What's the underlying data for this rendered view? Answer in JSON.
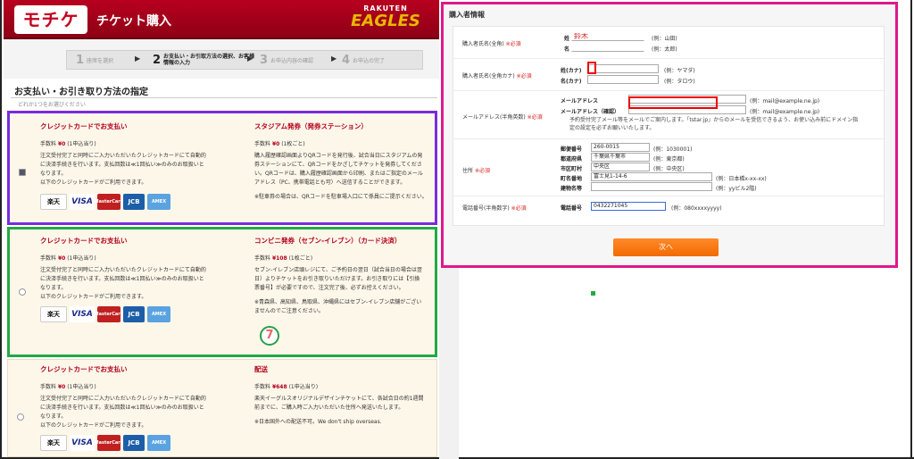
{
  "header": {
    "logo": "モチケ",
    "title": "チケット購入",
    "team_top": "RAKUTEN",
    "team_name": "EAGLES"
  },
  "steps": [
    {
      "num": "1",
      "label": "座席を選択"
    },
    {
      "num": "2",
      "label": "お支払い・お引取方法の選択、お客様情報の入力"
    },
    {
      "num": "3",
      "label": "お申込内容の確認"
    },
    {
      "num": "4",
      "label": "お申込の完了"
    }
  ],
  "section": {
    "title": "お支払い・お引き取り方法の指定",
    "subtitle": "どれか1つをお選びください"
  },
  "payment_cards": [
    {
      "left": {
        "title": "クレジットカードでお支払い",
        "fee_label": "手数料",
        "fee": "¥0",
        "fee_unit": "(1申込当り)",
        "lines": [
          "注文受付完了と同時にご入力いただいたクレジットカードにて自動的",
          "に決済手続きを行います。支払回数は≪1回払い≫のみのお取扱いと",
          "なります。",
          "以下のクレジットカードがご利用できます。"
        ]
      },
      "right": {
        "title": "スタジアム発券（発券ステーション）",
        "fee_label": "手数料",
        "fee": "¥0",
        "fee_unit": "(1枚ごと)",
        "lines": [
          "購入履歴確認画面よりQRコードを発行後、試合当日にスタジアムの発",
          "券ステーションにて、QRコードをかざしてチケットを発券してくださ",
          "い。QRコードは、購入履歴確認画面から印刷、またはご指定のメール",
          "アドレス（PC、携帯電話とも可）へ送信することができます。",
          "",
          "※駐車券の場合は、QRコードを駐車場入口にて係員にご提示ください。"
        ]
      }
    },
    {
      "left": {
        "title": "クレジットカードでお支払い",
        "fee_label": "手数料",
        "fee": "¥0",
        "fee_unit": "(1申込当り)",
        "lines": [
          "注文受付完了と同時にご入力いただいたクレジットカードにて自動的",
          "に決済手続きを行います。支払回数は≪1回払い≫のみのお取扱いと",
          "なります。",
          "以下のクレジットカードがご利用できます。"
        ]
      },
      "right": {
        "title": "コンビニ発券（セブン-イレブン）（カード決済）",
        "fee_label": "手数料",
        "fee": "¥108",
        "fee_unit": "(1枚ごと)",
        "lines": [
          "セブン-イレブン店頭レジにて、ご予約日の翌日（試合当日の場合は翌",
          "日）よりチケットをお引き取りいただけます。お引き取りには【引換",
          "票番号】が必要ですので、注文完了後、必ずお控えください。",
          "",
          "※青森県、高知県、鳥取県、沖縄県にはセブン-イレブン店舗がござい",
          "ませんのでご注意ください。"
        ]
      }
    },
    {
      "left": {
        "title": "クレジットカードでお支払い",
        "fee_label": "手数料",
        "fee": "¥0",
        "fee_unit": "(1申込当り)",
        "lines": [
          "注文受付完了と同時にご入力いただいたクレジットカードにて自動的",
          "に決済手続きを行います。支払回数は≪1回払い≫のみのお取扱いと",
          "なります。",
          "以下のクレジットカードがご利用できます。"
        ]
      },
      "right": {
        "title": "配送",
        "fee_label": "手数料",
        "fee": "¥648",
        "fee_unit": "(1申込当り)",
        "lines": [
          "楽天イーグルスオリジナルデザインチケットにて、各試合日の約1週間",
          "前までに、ご購入時ご入力いただいた住所へ発送いたします。",
          "",
          "※日本国外への配送不可。We don't ship overseas."
        ]
      }
    }
  ],
  "cc_logos": [
    "楽天",
    "VISA",
    "MasterCard",
    "JCB",
    "AMEX"
  ],
  "seven_logo": "7",
  "buyer": {
    "title": "購入者情報",
    "required": "※必須",
    "name": {
      "label": "購入者氏名(全角)",
      "sei_label": "姓",
      "mei_label": "名",
      "sei_value": "鈴木",
      "mei_value": "",
      "sei_ex": "(例：山田)",
      "mei_ex": "(例：太郎)"
    },
    "kana": {
      "label": "購入者氏名(全角カナ)",
      "sei_label": "姓(カナ)",
      "mei_label": "名(カナ)",
      "sei_value": "",
      "mei_value": "",
      "sei_ex": "(例：ヤマダ)",
      "mei_ex": "(例：タロウ)"
    },
    "email": {
      "label": "メールアドレス(半角英数)",
      "f1_label": "メールアドレス",
      "f2_label": "メールアドレス（確認）",
      "f1_value": "",
      "f2_value": "",
      "ex1": "(例：mail@example.ne.jp)",
      "ex2": "(例：mail@example.ne.jp)",
      "note1": "予約受付完了メール等をメールでご案内します。「tstar.jp」からのメールを受信できるよう、お使い込み前にドメイン指",
      "note2": "定の設定を必ずお願いいたします。"
    },
    "address": {
      "label": "住所",
      "fields": [
        {
          "label": "郵便番号",
          "value": "260-0015",
          "ex": "(例：1030001)"
        },
        {
          "label": "都道府県",
          "value": "千葉県千葉市",
          "ex": "(例：東京都)"
        },
        {
          "label": "市区町村",
          "value": "中央区",
          "ex": "(例：中央区)"
        },
        {
          "label": "町名番地",
          "value": "富士見1-14-6",
          "ex": "(例：日本橋x-xx-xx)"
        },
        {
          "label": "建物名等",
          "value": "",
          "ex": "(例：yyビル2階)"
        }
      ]
    },
    "phone": {
      "label": "電話番号(半角数字)",
      "field_label": "電話番号",
      "value": "0432271045",
      "ex": "(例：080xxxxyyyy)"
    },
    "next_button": "次へ"
  },
  "colors": {
    "brand_red": "#b8001f",
    "highlight_purple": "#7a2ae0",
    "highlight_green": "#22aa44",
    "highlight_pink": "#e0188a",
    "next_orange": "#f26a00"
  }
}
